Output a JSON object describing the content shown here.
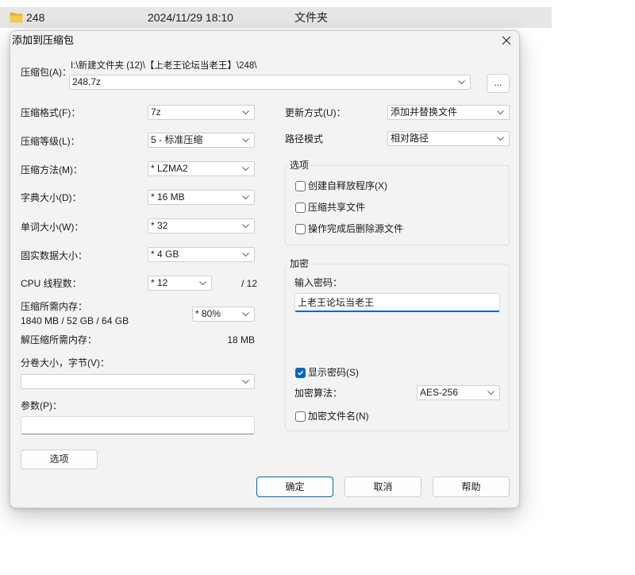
{
  "colors": {
    "accent": "#0067c0",
    "folder": "#f8c94c"
  },
  "explorer": {
    "icon": "folder-icon",
    "name": "248",
    "date": "2024/11/29 18:10",
    "type": "文件夹"
  },
  "dialog": {
    "title": "添加到压缩包",
    "close_icon": "close-icon",
    "archive": {
      "label": "压缩包(A)：",
      "path": "I:\\新建文件夹 (12)\\【上老王论坛当老王】\\248\\",
      "value": "248.7z",
      "browse": "..."
    },
    "format": {
      "label": "压缩格式(F)：",
      "value": "7z"
    },
    "level": {
      "label": "压缩等级(L)：",
      "value": "5 - 标准压缩"
    },
    "method": {
      "label": "压缩方法(M)：",
      "value": "* LZMA2"
    },
    "dictionary": {
      "label": "字典大小(D)：",
      "value": "* 16 MB"
    },
    "word": {
      "label": "单词大小(W)：",
      "value": "* 32"
    },
    "solid": {
      "label": "固实数据大小：",
      "value": "* 4 GB"
    },
    "threads": {
      "label": "CPU 线程数：",
      "value": "* 12",
      "max": "/ 12"
    },
    "memory_compress": {
      "label": "压缩所需内存：",
      "detail": "1840 MB / 52 GB / 64 GB",
      "value": "* 80%"
    },
    "memory_decompress": {
      "label": "解压缩所需内存：",
      "value": "18 MB"
    },
    "volume": {
      "label": "分卷大小，字节(V)：",
      "value": ""
    },
    "params": {
      "label": "参数(P)：",
      "value": ""
    },
    "options_button": "选项",
    "update_mode": {
      "label": "更新方式(U)：",
      "value": "添加并替换文件"
    },
    "path_mode": {
      "label": "路径模式",
      "value": "相对路径"
    },
    "options_group": {
      "title": "选项",
      "items": [
        {
          "label": "创建自释放程序(X)",
          "checked": false
        },
        {
          "label": "压缩共享文件",
          "checked": false
        },
        {
          "label": "操作完成后删除源文件",
          "checked": false
        }
      ]
    },
    "encryption": {
      "title": "加密",
      "password_label": "输入密码：",
      "password": "上老王论坛当老王",
      "show_password": {
        "label": "显示密码(S)",
        "checked": true
      },
      "method_label": "加密算法：",
      "method": "AES-256",
      "encrypt_names": {
        "label": "加密文件名(N)",
        "checked": false
      }
    },
    "buttons": {
      "ok": "确定",
      "cancel": "取消",
      "help": "帮助"
    }
  }
}
